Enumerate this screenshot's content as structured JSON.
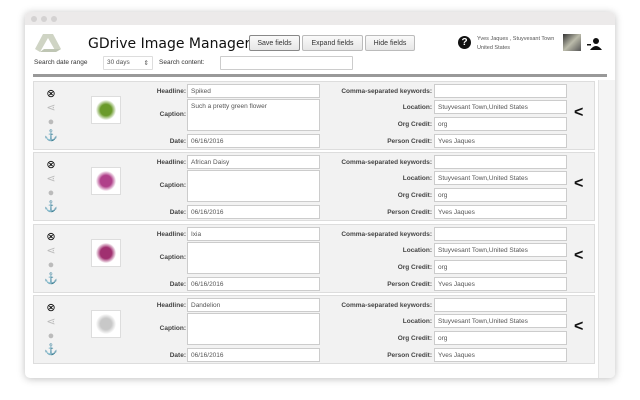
{
  "app": {
    "title": "GDrive Image Manager"
  },
  "toolbar": {
    "save_label": "Save fields",
    "expand_label": "Expand fields",
    "hide_label": "Hide fields"
  },
  "user": {
    "info": "Yves Jaques , Stuyvesant Town United States"
  },
  "search": {
    "date_label": "Search date range",
    "date_value": "30 days",
    "content_label": "Search content:",
    "content_value": ""
  },
  "labels": {
    "headline": "Headline:",
    "caption": "Caption:",
    "date": "Date:",
    "keywords": "Comma-separated keywords:",
    "location": "Location:",
    "org": "Org Credit:",
    "person": "Person Credit:"
  },
  "colors": {
    "flowers": [
      "#6a9a2a",
      "#b0408a",
      "#a03070",
      "#c8c8c8"
    ]
  },
  "rows": [
    {
      "headline": "Spiked",
      "caption": "Such a pretty green flower",
      "date": "06/16/2016",
      "keywords": "",
      "location": "Stuyvesant Town,United States",
      "org": "org",
      "person": "Yves Jaques"
    },
    {
      "headline": "African Daisy",
      "caption": "",
      "date": "06/16/2016",
      "keywords": "",
      "location": "Stuyvesant Town,United States",
      "org": "org",
      "person": "Yves Jaques"
    },
    {
      "headline": "Ixia",
      "caption": "",
      "date": "06/16/2016",
      "keywords": "",
      "location": "Stuyvesant Town,United States",
      "org": "org",
      "person": "Yves Jaques"
    },
    {
      "headline": "Dandelion",
      "caption": "",
      "date": "06/16/2016",
      "keywords": "",
      "location": "Stuyvesant Town,United States",
      "org": "org",
      "person": "Yves Jaques"
    }
  ]
}
